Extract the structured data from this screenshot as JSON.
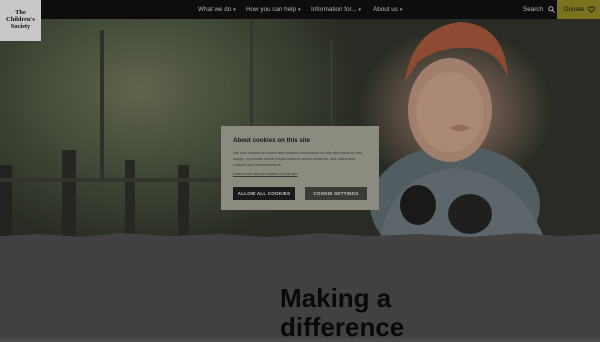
{
  "brand": {
    "logo_lines": [
      "The",
      "Children's",
      "Society"
    ]
  },
  "nav": {
    "items": [
      {
        "label": "What we do"
      },
      {
        "label": "How you can help"
      },
      {
        "label": "Information for..."
      },
      {
        "label": "About us"
      }
    ],
    "search_label": "Search",
    "donate_label": "Donate"
  },
  "main": {
    "headline_lines": [
      "Making a",
      "difference"
    ]
  },
  "cookie_modal": {
    "title": "About cookies on this site",
    "body": "We use cookies to collect and analyse information on site performance and usage, to provide social media features and to enhance and customise content and advertisements.",
    "learn_more": "Learn more about cookies on this site",
    "allow_all_label": "ALLOW ALL COOKIES",
    "settings_label": "COOKIE SETTINGS"
  }
}
